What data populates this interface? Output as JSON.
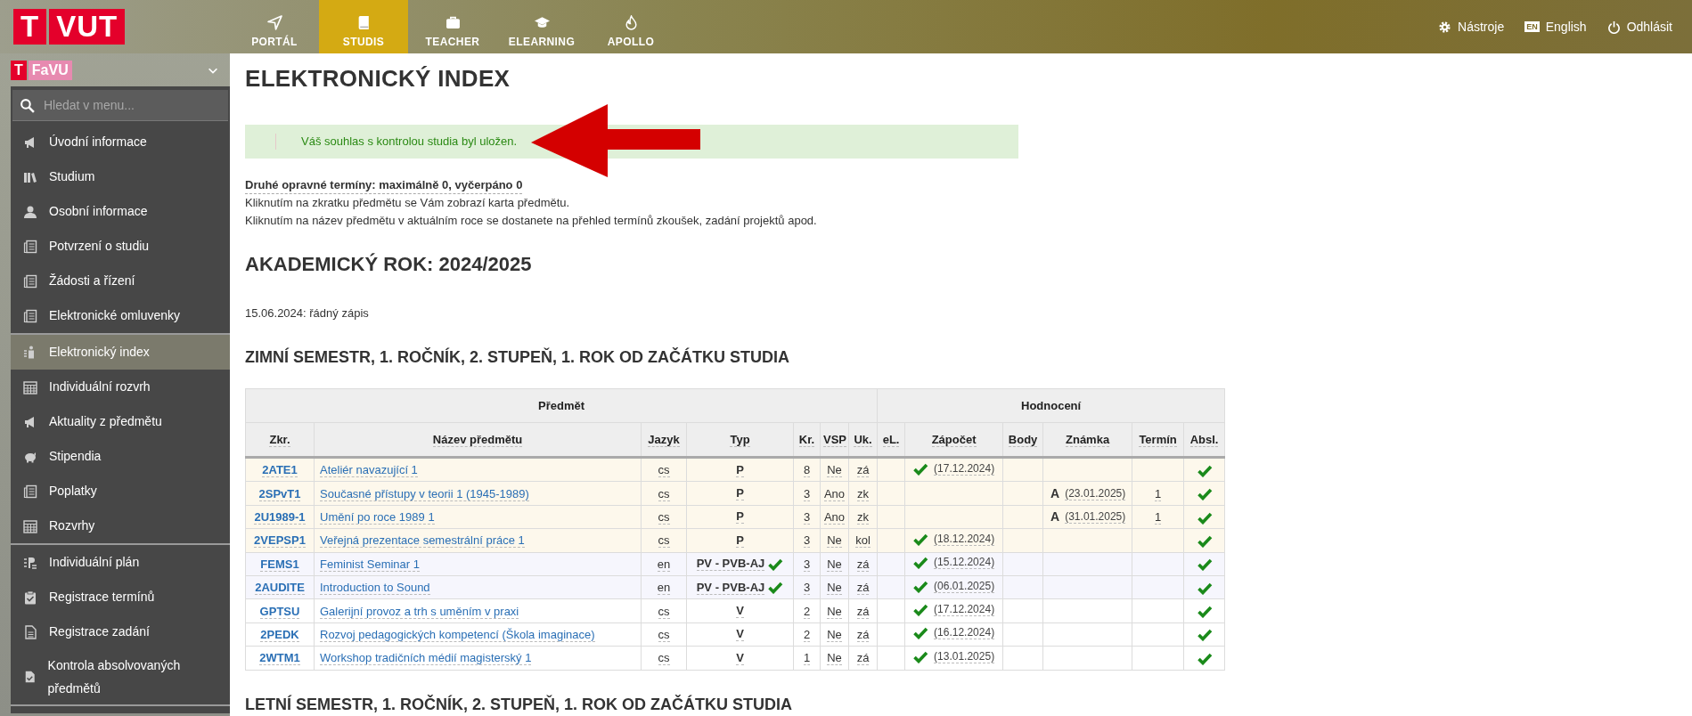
{
  "logo": {
    "mark": "T",
    "text": "VUT"
  },
  "nav": [
    {
      "label": "PORTÁL",
      "selected": false
    },
    {
      "label": "STUDIS",
      "selected": true
    },
    {
      "label": "TEACHER",
      "selected": false
    },
    {
      "label": "ELEARNING",
      "selected": false
    },
    {
      "label": "APOLLO",
      "selected": false
    }
  ],
  "top_links": [
    {
      "label": "Nástroje"
    },
    {
      "label": "English",
      "badge": "EN"
    },
    {
      "label": "Odhlásit"
    }
  ],
  "sidebar": {
    "faculty": {
      "mark": "T",
      "text": "FaVU"
    },
    "search": {
      "placeholder": "Hledat v menu..."
    },
    "sections": [
      [
        {
          "label": "Úvodní informace",
          "selected": false
        },
        {
          "label": "Studium",
          "selected": false
        },
        {
          "label": "Osobní informace",
          "selected": false
        },
        {
          "label": "Potvrzení o studiu",
          "selected": false
        },
        {
          "label": "Žádosti a řízení",
          "selected": false
        },
        {
          "label": "Elektronické omluvenky",
          "selected": false
        }
      ],
      [
        {
          "label": "Elektronický index",
          "selected": true
        },
        {
          "label": "Individuální rozvrh",
          "selected": false
        },
        {
          "label": "Aktuality z předmětu",
          "selected": false
        },
        {
          "label": "Stipendia",
          "selected": false
        },
        {
          "label": "Poplatky",
          "selected": false
        },
        {
          "label": "Rozvrhy",
          "selected": false
        }
      ],
      [
        {
          "label": "Individuální plán",
          "selected": false
        },
        {
          "label": "Registrace termínů",
          "selected": false
        },
        {
          "label": "Registrace zadání",
          "selected": false
        },
        {
          "label": "Kontrola absolvovaných předmětů",
          "selected": false
        }
      ]
    ]
  },
  "page": {
    "title": "ELEKTRONICKÝ INDEX",
    "message": {
      "kind": "success",
      "text": "Váš souhlas s kontrolou studia byl uložen."
    },
    "annotation": {
      "kind": "arrow"
    },
    "info_bold": "Druhé opravné termíny: maximálně 0, vyčerpáno 0",
    "info_lines": [
      "Kliknutím na zkratku předmětu se Vám zobrazí karta předmětu.",
      "Kliknutím na název předmětu v aktuálním roce se dostanete na přehled termínů zkoušek, zadání projektů apod."
    ],
    "year_heading": "AKADEMICKÝ ROK: 2024/2025",
    "enrollment": "15.06.2024: řádný zápis",
    "semester_heading": "ZIMNÍ SEMESTR, 1. ROČNÍK, 2. STUPEŇ, 1. ROK OD ZAČÁTKU STUDIA",
    "table": {
      "groups": [
        "Předmět",
        "Hodnocení"
      ],
      "columns": [
        "Zkr.",
        "Název předmětu",
        "Jazyk",
        "Typ",
        "Kr.",
        "VSP",
        "Uk.",
        "eL.",
        "Zápočet",
        "Body",
        "Známka",
        "Termín",
        "Absl."
      ],
      "rows": [
        {
          "code": "2ATE1",
          "name": "Ateliér navazující 1",
          "lang": "cs",
          "type": "P",
          "type_checked": false,
          "credits": "8",
          "vsp": "Ne",
          "completion": "zá",
          "credit_passed": true,
          "credit_date": "(17.12.2024)",
          "absolved": true,
          "color": "#fdf8ec"
        },
        {
          "code": "2SPvT1",
          "name": "Současné přístupy v teorii 1 (1945-1989)",
          "lang": "cs",
          "type": "P",
          "type_checked": false,
          "credits": "3",
          "vsp": "Ano",
          "completion": "zk",
          "credit_passed": false,
          "grade": "A",
          "grade_date": "(23.01.2025)",
          "attempt": "1",
          "absolved": true,
          "color": "#fdf8ec"
        },
        {
          "code": "2U1989-1",
          "name": "Umění po roce 1989 1",
          "lang": "cs",
          "type": "P",
          "type_checked": false,
          "credits": "3",
          "vsp": "Ano",
          "completion": "zk",
          "credit_passed": false,
          "grade": "A",
          "grade_date": "(31.01.2025)",
          "attempt": "1",
          "absolved": true,
          "color": "#fdf8ec"
        },
        {
          "code": "2VEPSP1",
          "name": "Veřejná prezentace semestrální práce 1",
          "lang": "cs",
          "type": "P",
          "type_checked": false,
          "credits": "3",
          "vsp": "Ne",
          "completion": "kol",
          "credit_passed": true,
          "credit_date": "(18.12.2024)",
          "absolved": true,
          "color": "#fdf8ec"
        },
        {
          "code": "FEMS1",
          "name": "Feminist Seminar 1",
          "lang": "en",
          "type": "PV - PVB-AJ",
          "type_checked": true,
          "credits": "3",
          "vsp": "Ne",
          "completion": "zá",
          "credit_passed": true,
          "credit_date": "(15.12.2024)",
          "absolved": true,
          "color": "#f6f6fd"
        },
        {
          "code": "2AUDITE",
          "name": "Introduction to Sound",
          "lang": "en",
          "type": "PV - PVB-AJ",
          "type_checked": true,
          "credits": "3",
          "vsp": "Ne",
          "completion": "zá",
          "credit_passed": true,
          "credit_date": "(06.01.2025)",
          "absolved": true,
          "color": "#f6f6fd"
        },
        {
          "code": "GPTSU",
          "name": "Galerijní provoz a trh s uměním v praxi",
          "lang": "cs",
          "type": "V",
          "type_checked": false,
          "credits": "2",
          "vsp": "Ne",
          "completion": "zá",
          "credit_passed": true,
          "credit_date": "(17.12.2024)",
          "absolved": true,
          "color": "#ffffff"
        },
        {
          "code": "2PEDK",
          "name": "Rozvoj pedagogických kompetencí (Škola imaginace)",
          "lang": "cs",
          "type": "V",
          "type_checked": false,
          "credits": "2",
          "vsp": "Ne",
          "completion": "zá",
          "credit_passed": true,
          "credit_date": "(16.12.2024)",
          "absolved": true,
          "color": "#ffffff"
        },
        {
          "code": "2WTM1",
          "name": "Workshop tradičních médií magisterský 1",
          "lang": "cs",
          "type": "V",
          "type_checked": false,
          "credits": "1",
          "vsp": "Ne",
          "completion": "zá",
          "credit_passed": true,
          "credit_date": "(13.01.2025)",
          "absolved": true,
          "color": "#ffffff"
        }
      ]
    },
    "next_semester_heading": "LETNÍ SEMESTR, 1. ROČNÍK, 2. STUPEŇ, 1. ROK OD ZAČÁTKU STUDIA"
  }
}
